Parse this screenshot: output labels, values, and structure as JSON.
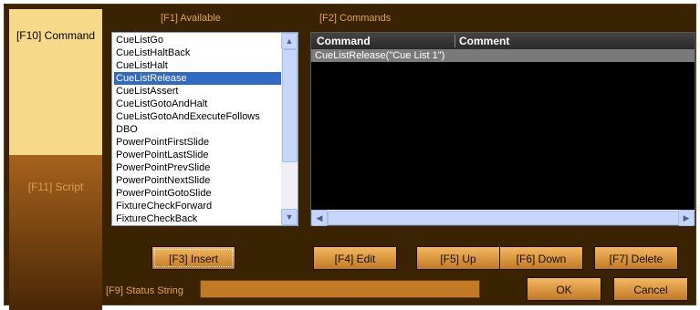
{
  "tabs": {
    "command_label": "[F10] Command",
    "script_label": "[F11] Script"
  },
  "available": {
    "label": "[F1] Available",
    "items": [
      {
        "label": "CueListGo"
      },
      {
        "label": "CueListHaltBack"
      },
      {
        "label": "CueListHalt"
      },
      {
        "label": "CueListRelease"
      },
      {
        "label": "CueListAssert"
      },
      {
        "label": "CueListGotoAndHalt"
      },
      {
        "label": "CueListGotoAndExecuteFollows"
      },
      {
        "label": "DBO"
      },
      {
        "label": "PowerPointFirstSlide"
      },
      {
        "label": "PowerPointLastSlide"
      },
      {
        "label": "PowerPointPrevSlide"
      },
      {
        "label": "PowerPointNextSlide"
      },
      {
        "label": "PowerPointGotoSlide"
      },
      {
        "label": "FixtureCheckForward"
      },
      {
        "label": "FixtureCheckBack"
      }
    ],
    "selected_index": 3
  },
  "commands": {
    "label": "[F2] Commands",
    "columns": {
      "command": "Command",
      "comment": "Comment"
    },
    "rows": [
      {
        "command": "CueListRelease(\"Cue List 1\")",
        "comment": ""
      }
    ]
  },
  "buttons": {
    "insert": "[F3] Insert",
    "edit": "[F4] Edit",
    "up": "[F5] Up",
    "down": "[F6] Down",
    "delete": "[F7] Delete",
    "ok": "OK",
    "cancel": "Cancel"
  },
  "status": {
    "label": "[F9] Status String",
    "value": ""
  },
  "colors": {
    "background": "#3a2303",
    "active_tab": "#f7d98a",
    "button": "#e8a440",
    "selection": "#316ac5"
  },
  "icons": {
    "scroll_up": "chevron-up-icon",
    "scroll_down": "chevron-down-icon",
    "scroll_left": "chevron-left-icon",
    "scroll_right": "chevron-right-icon"
  }
}
